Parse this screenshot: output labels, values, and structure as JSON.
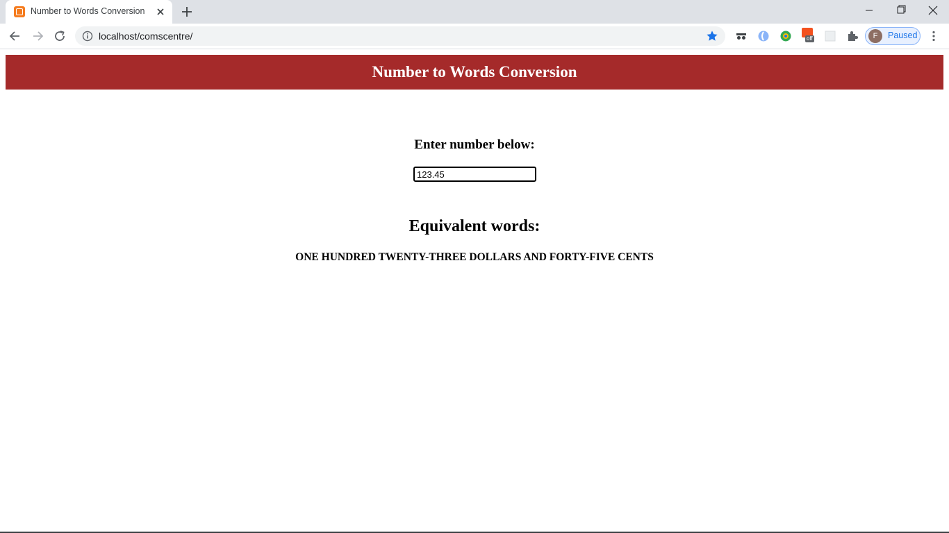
{
  "browser": {
    "tab_title": "Number to Words Conversion",
    "url": "localhost/comscentre/",
    "profile_initial": "F",
    "profile_status": "Paused",
    "extension_badge": "off"
  },
  "page": {
    "title": "Number to Words Conversion",
    "prompt_label": "Enter number below:",
    "number_input_value": "123.45",
    "result_heading": "Equivalent words:",
    "result_text": "ONE HUNDRED TWENTY-THREE DOLLARS AND FORTY-FIVE CENTS"
  },
  "colors": {
    "banner": "#a52a2a",
    "accent_blue": "#1a73e8"
  }
}
